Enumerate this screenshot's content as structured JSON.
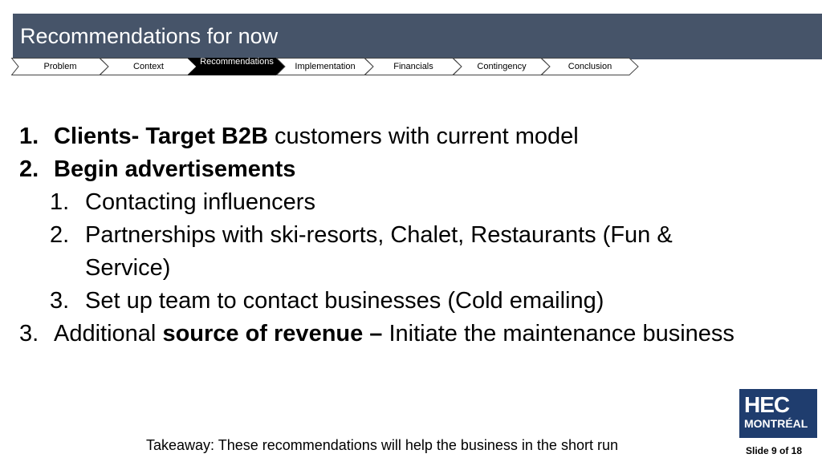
{
  "slide": {
    "title": "Recommendations for now",
    "breadcrumb": [
      {
        "label": "Problem",
        "active": false
      },
      {
        "label": "Context",
        "active": false
      },
      {
        "label": "Recommendations",
        "active": true
      },
      {
        "label": "Implementation",
        "active": false
      },
      {
        "label": "Financials",
        "active": false
      },
      {
        "label": "Contingency",
        "active": false
      },
      {
        "label": "Conclusion",
        "active": false
      }
    ],
    "items": [
      {
        "num": "1.",
        "bold": "Clients- Target B2B",
        "rest": " customers with current model"
      },
      {
        "num": "2.",
        "bold": "Begin advertisements",
        "rest": ""
      },
      {
        "num": "1.",
        "text": "Contacting influencers"
      },
      {
        "num": "2.",
        "text": "Partnerships with ski-resorts, Chalet, Restaurants (Fun & Service)"
      },
      {
        "num": "3.",
        "text": "Set up team to contact businesses (Cold emailing)"
      },
      {
        "num": "3.",
        "pre": "Additional ",
        "bold": "source of revenue –",
        "rest": " Initiate the maintenance business"
      }
    ],
    "takeaway": "Takeaway: These recommendations will help the business in the short run",
    "logo": {
      "line1": "HEC",
      "line2": "MONTRÉAL"
    },
    "slide_number": "Slide 9 of 18",
    "colors": {
      "title_bar": "#465469",
      "active_crumb": "#000000",
      "logo_bg": "#1f3d6e"
    }
  }
}
